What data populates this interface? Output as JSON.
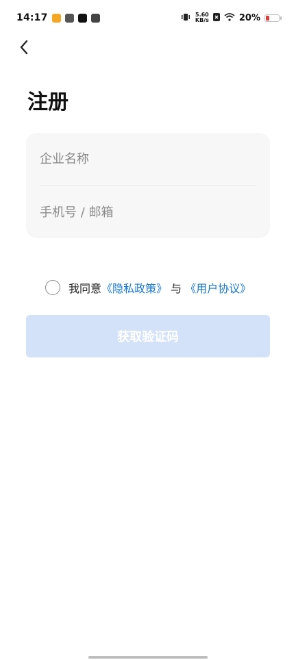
{
  "status_bar": {
    "time": "14:17",
    "speed_value": "5.60",
    "speed_unit": "KB/s",
    "battery_percent": "20%",
    "app_icons": [
      "weibo-icon",
      "link-icon",
      "tiktok-icon",
      "mail-icon"
    ]
  },
  "page": {
    "title": "注册"
  },
  "form": {
    "company_placeholder": "企业名称",
    "contact_placeholder": "手机号 / 邮箱"
  },
  "agreement": {
    "prefix": "我同意",
    "privacy_link": "《隐私政策》",
    "joiner": "与",
    "user_link": "《用户协议》"
  },
  "actions": {
    "get_code_label": "获取验证码"
  },
  "colors": {
    "link": "#1677c9",
    "button_disabled_bg": "#d3e1f9",
    "battery_low": "#e53935"
  }
}
